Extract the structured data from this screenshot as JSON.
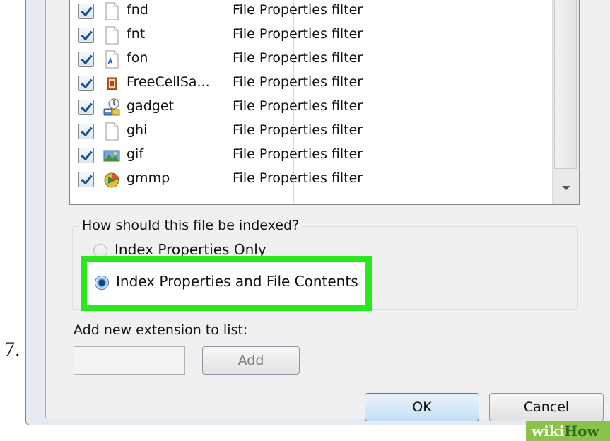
{
  "step_number": "7.",
  "file_list": {
    "rows": [
      {
        "extension": "fnd",
        "type": "File Properties filter",
        "icon": "blank-file-icon"
      },
      {
        "extension": "fnt",
        "type": "File Properties filter",
        "icon": "blank-file-icon"
      },
      {
        "extension": "fon",
        "type": "File Properties filter",
        "icon": "font-file-icon"
      },
      {
        "extension": "FreeCellSa...",
        "type": "File Properties filter",
        "icon": "freecell-icon"
      },
      {
        "extension": "gadget",
        "type": "File Properties filter",
        "icon": "gadget-icon"
      },
      {
        "extension": "ghi",
        "type": "File Properties filter",
        "icon": "blank-file-icon"
      },
      {
        "extension": "gif",
        "type": "File Properties filter",
        "icon": "image-file-icon"
      },
      {
        "extension": "gmmp",
        "type": "File Properties filter",
        "icon": "media-file-icon"
      }
    ]
  },
  "index_options": {
    "legend": "How should this file be indexed?",
    "option_properties_only": "Index Properties Only",
    "option_properties_and_contents": "Index Properties and File Contents",
    "selected": "option_properties_and_contents"
  },
  "add_extension": {
    "label": "Add new extension to list:",
    "input_value": "",
    "add_button": "Add"
  },
  "footer": {
    "ok_button": "OK",
    "cancel_button": "Cancel"
  },
  "watermark": {
    "part1": "wiki",
    "part2": "How"
  },
  "colors": {
    "highlight": "#27e91d",
    "checkmark": "#1c4d99",
    "ok_button_border": "#3c7fb1"
  }
}
